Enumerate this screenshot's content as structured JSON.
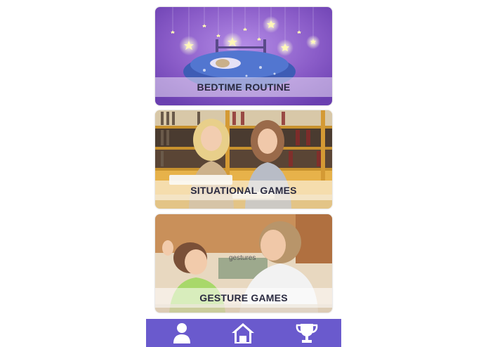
{
  "cards": [
    {
      "label": "BEDTIME ROUTINE"
    },
    {
      "label": "SITUATIONAL GAMES"
    },
    {
      "label": "GESTURE GAMES",
      "overlay_text": "gestures"
    }
  ],
  "bottom_nav": {
    "items": [
      {
        "icon": "user-icon"
      },
      {
        "icon": "home-icon"
      },
      {
        "icon": "trophy-icon"
      }
    ]
  },
  "colors": {
    "nav_background": "#6a5acd",
    "bedtime_purple": "#8a5cc8",
    "library_wood": "#e7b24a"
  }
}
